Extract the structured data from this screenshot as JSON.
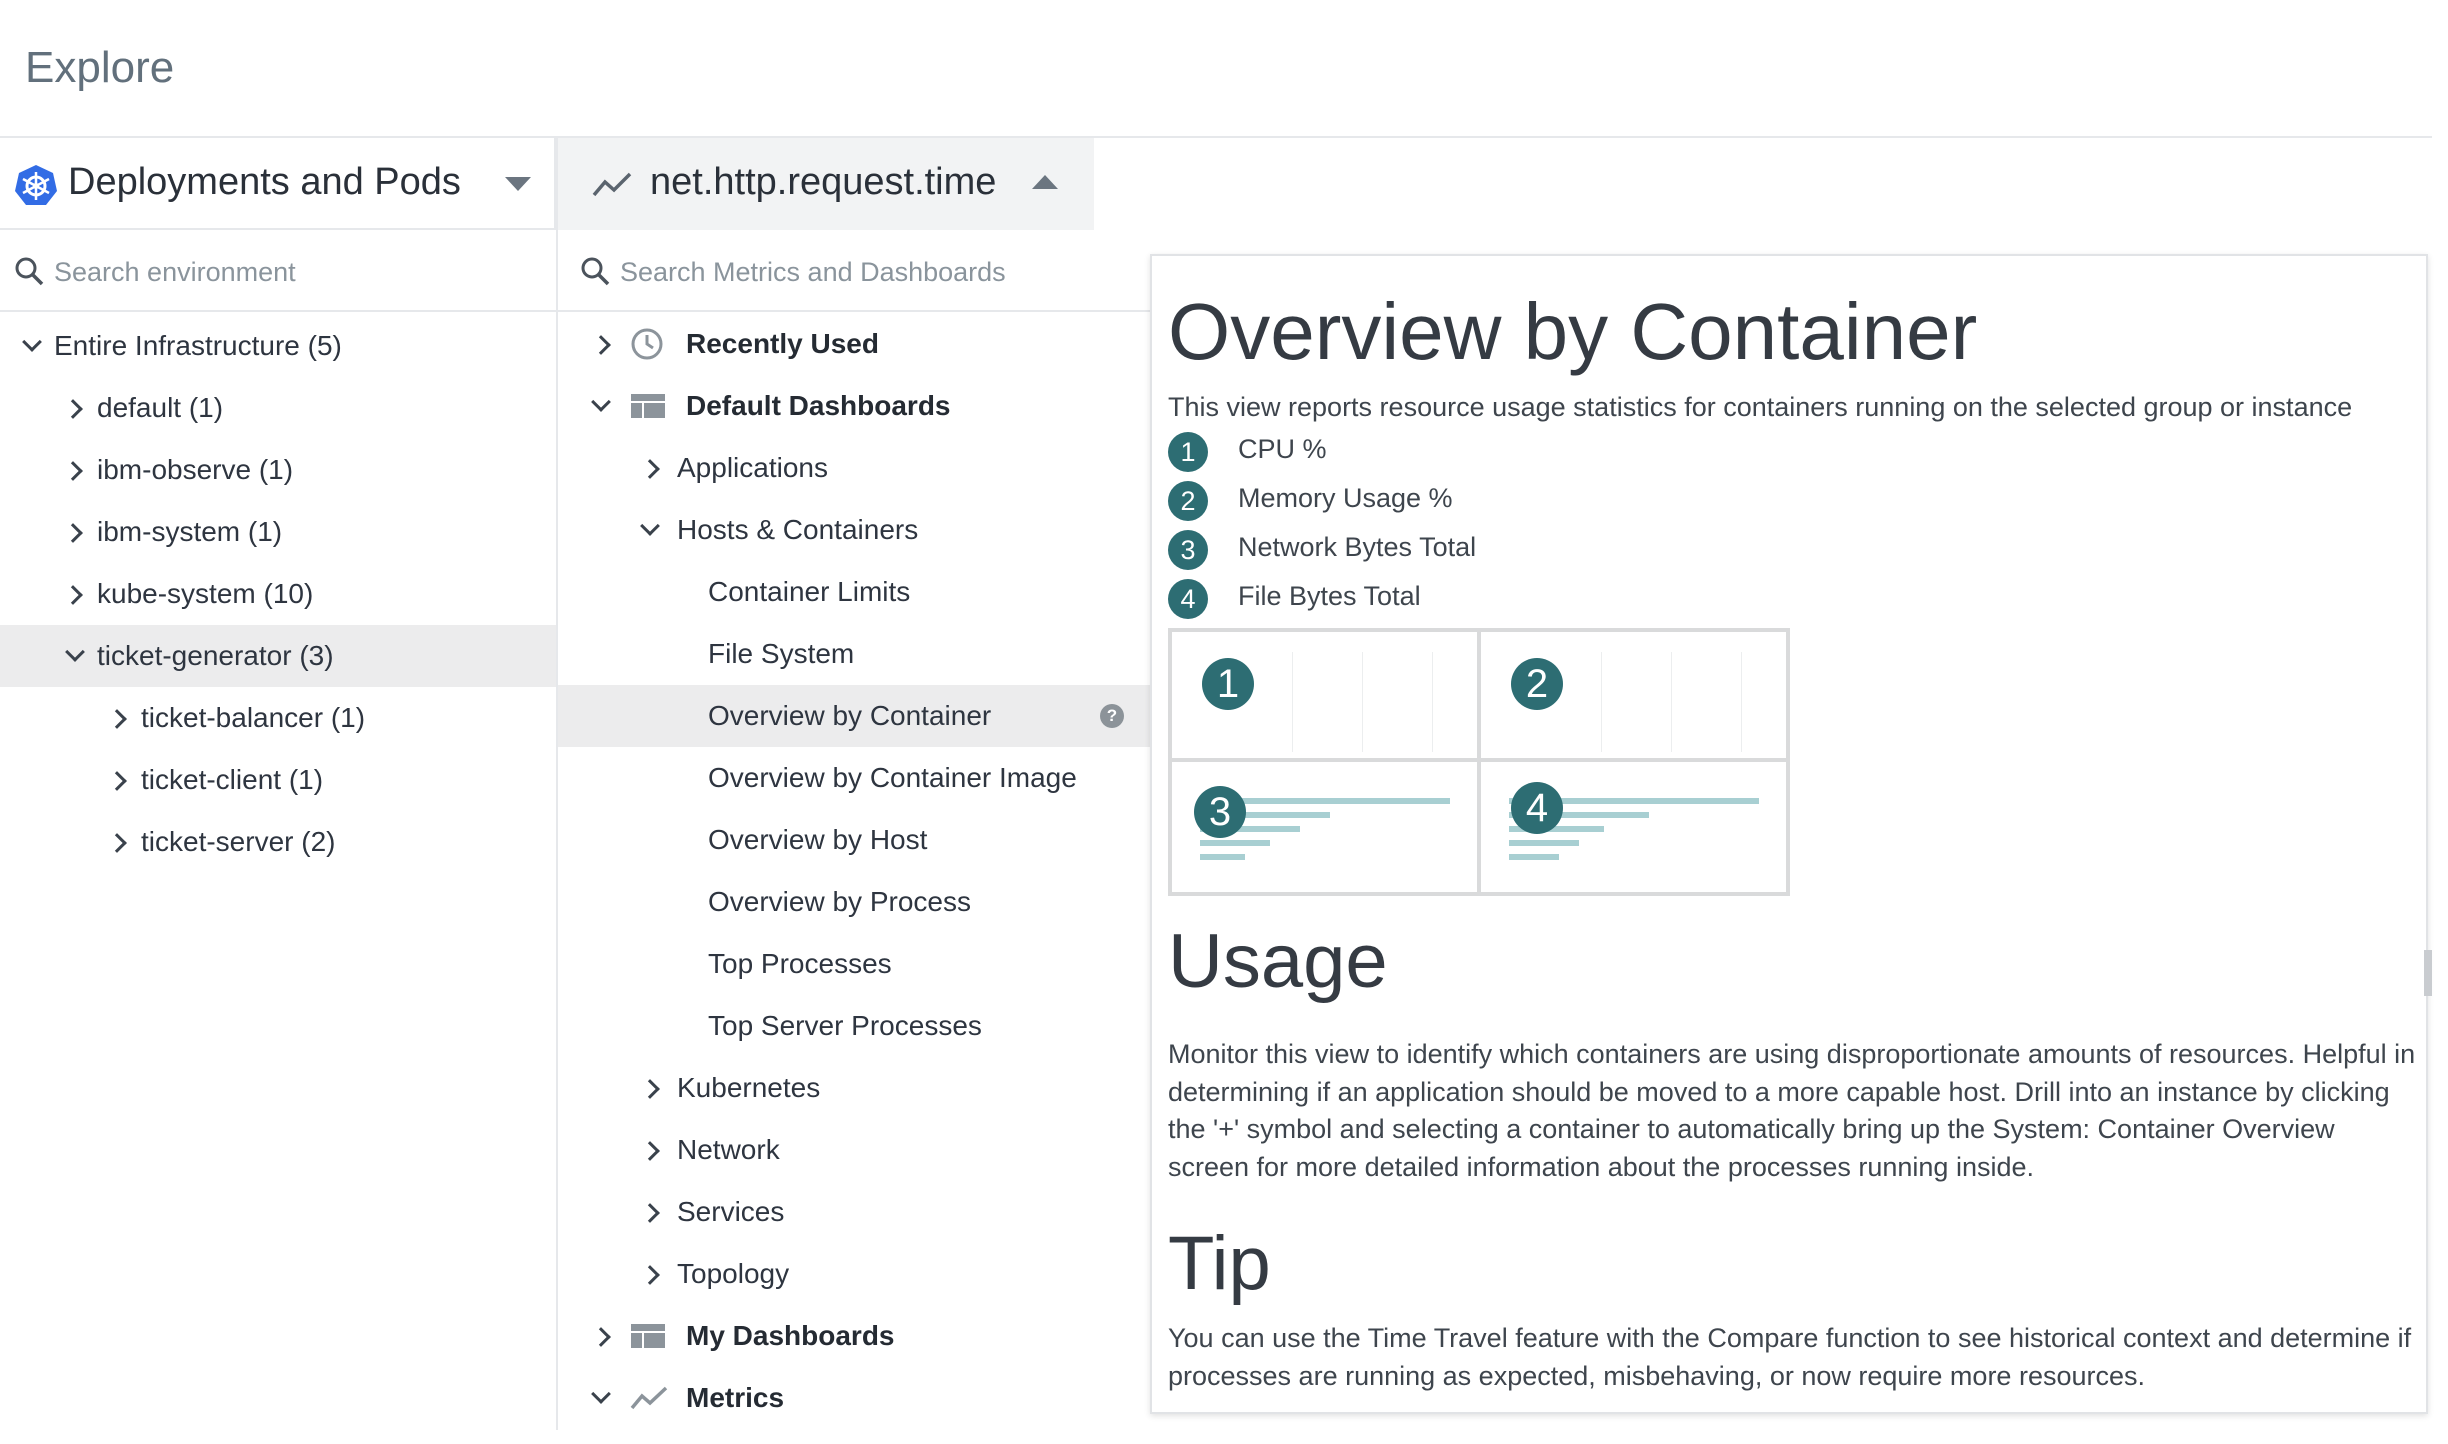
{
  "page": {
    "title": "Explore"
  },
  "environment": {
    "selector_label": "Deployments and Pods",
    "search_placeholder": "Search environment",
    "tree": [
      {
        "label": "Entire Infrastructure (5)",
        "state": "expanded"
      },
      {
        "label": "default (1)",
        "state": "collapsed"
      },
      {
        "label": "ibm-observe (1)",
        "state": "collapsed"
      },
      {
        "label": "ibm-system (1)",
        "state": "collapsed"
      },
      {
        "label": "kube-system (10)",
        "state": "collapsed"
      },
      {
        "label": "ticket-generator (3)",
        "state": "expanded",
        "selected": true
      },
      {
        "label": "ticket-balancer (1)",
        "state": "collapsed"
      },
      {
        "label": "ticket-client (1)",
        "state": "collapsed"
      },
      {
        "label": "ticket-server (2)",
        "state": "collapsed"
      }
    ]
  },
  "metrics": {
    "selector_label": "net.http.request.time",
    "search_placeholder": "Search Metrics and Dashboards",
    "tree": [
      {
        "label": "Recently Used",
        "icon": "clock-icon"
      },
      {
        "label": "Default Dashboards",
        "icon": "dashboard-icon"
      },
      {
        "label": "Applications"
      },
      {
        "label": "Hosts & Containers"
      },
      {
        "label": "Container Limits"
      },
      {
        "label": "File System"
      },
      {
        "label": "Overview by Container",
        "selected": true
      },
      {
        "label": "Overview by Container Image"
      },
      {
        "label": "Overview by Host"
      },
      {
        "label": "Overview by Process"
      },
      {
        "label": "Top Processes"
      },
      {
        "label": "Top Server Processes"
      },
      {
        "label": "Kubernetes"
      },
      {
        "label": "Network"
      },
      {
        "label": "Services"
      },
      {
        "label": "Topology"
      },
      {
        "label": "My Dashboards",
        "icon": "dashboard-icon"
      },
      {
        "label": "Metrics",
        "icon": "metric-line-icon"
      }
    ],
    "help_badge": "?"
  },
  "help": {
    "title": "Overview by Container",
    "description": "This view reports resource usage statistics for containers running on the selected group or instance",
    "items": [
      {
        "num": "1",
        "label": "CPU %"
      },
      {
        "num": "2",
        "label": "Memory Usage %"
      },
      {
        "num": "3",
        "label": "Network Bytes Total"
      },
      {
        "num": "4",
        "label": "File Bytes Total"
      }
    ],
    "usage_title": "Usage",
    "usage_text": "Monitor this view to identify which containers are using disproportionate amounts of resources. Helpful in determining if an application should be moved to a more capable host. Drill into an instance by clicking the '+' symbol and selecting a container to automatically bring up the System: Container Overview screen for more detailed information about the processes running inside.",
    "tip_title": "Tip",
    "tip_text": "You can use the Time Travel feature with the Compare function to see historical context and determine if processes are running as expected, misbehaving, or now require more resources."
  },
  "colors": {
    "badge": "#2d6d73",
    "selected_row": "#ececed",
    "divider": "#e6e8eb"
  }
}
